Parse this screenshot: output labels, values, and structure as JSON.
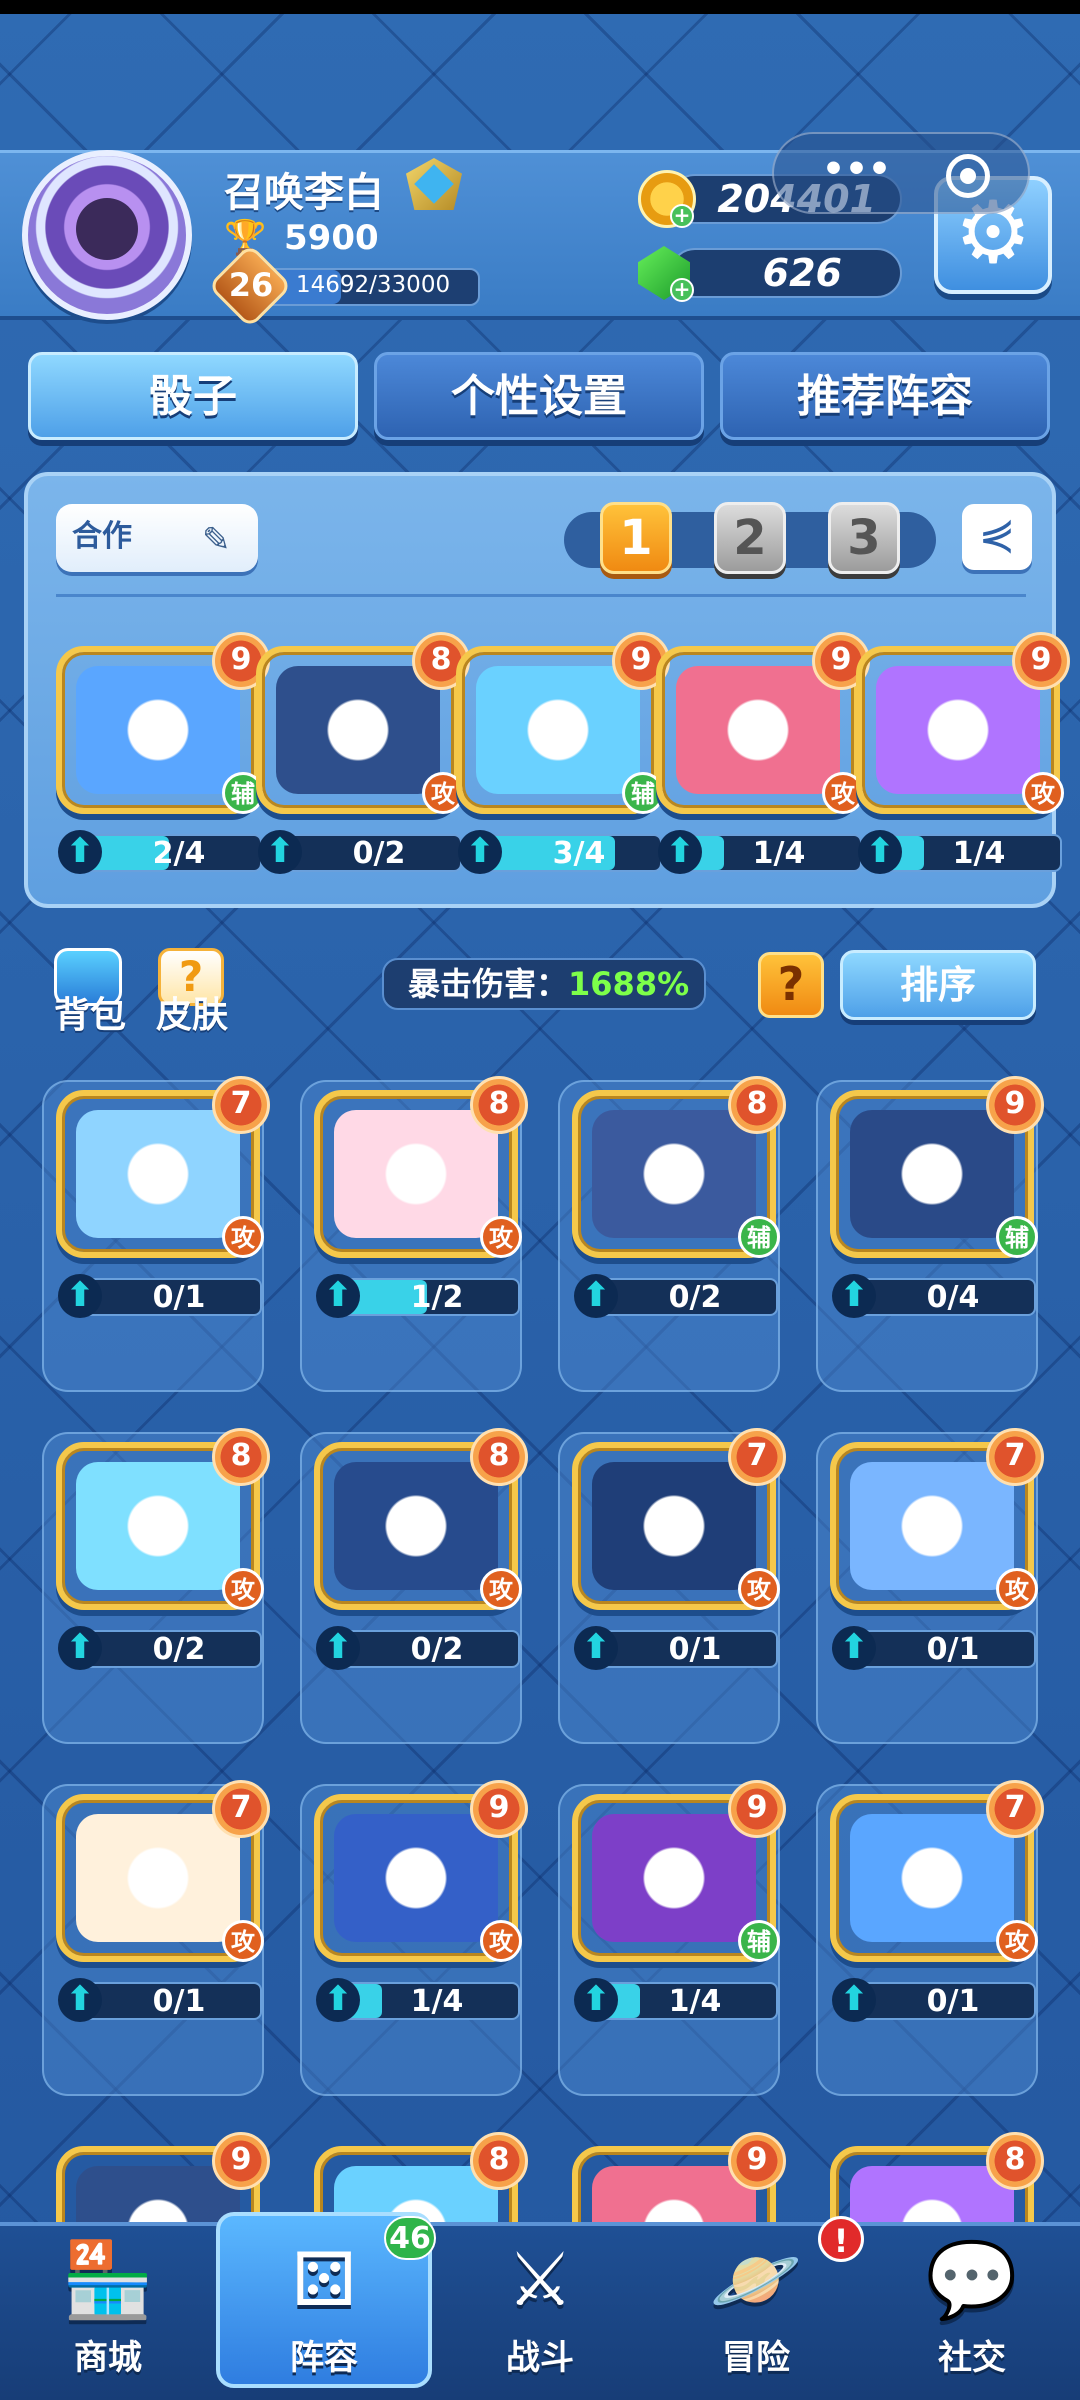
{
  "colors": {
    "accent": "#4ea0e8",
    "attack_role": "#e0601f",
    "support_role": "#3ab54a",
    "crit_value": "#7dff4a",
    "gold": "#ffc23a"
  },
  "player": {
    "name": "召唤李白",
    "trophies": "5900",
    "level": "26",
    "xp": "14692/33000",
    "xp_fraction": 0.445
  },
  "currency": {
    "gold": "204401",
    "gems": "626"
  },
  "tabs": [
    "骰子",
    "个性设置",
    "推荐阵容"
  ],
  "deck": {
    "name": "合作",
    "pages": [
      "1",
      "2",
      "3"
    ],
    "active_page": "1",
    "slots": [
      {
        "icon": "ninja-mask-icon",
        "level": "9",
        "role": "辅",
        "progress": "2/4",
        "fraction": 0.5
      },
      {
        "icon": "lion-icon",
        "level": "8",
        "role": "攻",
        "progress": "0/2",
        "fraction": 0
      },
      {
        "icon": "vortex-icon",
        "level": "9",
        "role": "辅",
        "progress": "3/4",
        "fraction": 0.75
      },
      {
        "icon": "red-gift-icon",
        "level": "9",
        "role": "攻",
        "progress": "1/4",
        "fraction": 0.25
      },
      {
        "icon": "purple-cross-icon",
        "level": "9",
        "role": "攻",
        "progress": "1/4",
        "fraction": 0.25
      }
    ]
  },
  "side": {
    "bag_label": "背包",
    "skin_label": "皮肤"
  },
  "crit": {
    "label": "暴击伤害：",
    "value": "1688%"
  },
  "help_label": "?",
  "sort_label": "排序",
  "collection": [
    {
      "icon": "shark-icon",
      "level": "7",
      "role": "攻",
      "progress": "0/1",
      "fraction": 0
    },
    {
      "icon": "rabbit-icon",
      "level": "8",
      "role": "攻",
      "progress": "1/2",
      "fraction": 0.5
    },
    {
      "icon": "ram-icon",
      "level": "8",
      "role": "辅",
      "progress": "0/2",
      "fraction": 0
    },
    {
      "icon": "libra-scales-icon",
      "level": "9",
      "role": "辅",
      "progress": "0/4",
      "fraction": 0
    },
    {
      "icon": "virgo-maiden-icon",
      "level": "8",
      "role": "攻",
      "progress": "0/2",
      "fraction": 0
    },
    {
      "icon": "leo-lion-icon",
      "level": "8",
      "role": "攻",
      "progress": "0/2",
      "fraction": 0
    },
    {
      "icon": "crab-icon",
      "level": "7",
      "role": "攻",
      "progress": "0/1",
      "fraction": 0
    },
    {
      "icon": "pisces-fish-icon",
      "level": "7",
      "role": "攻",
      "progress": "0/1",
      "fraction": 0
    },
    {
      "icon": "aquarius-icon",
      "level": "7",
      "role": "攻",
      "progress": "0/1",
      "fraction": 0
    },
    {
      "icon": "tiger-icon",
      "level": "9",
      "role": "攻",
      "progress": "1/4",
      "fraction": 0.25
    },
    {
      "icon": "shield-cross-icon",
      "level": "9",
      "role": "辅",
      "progress": "1/4",
      "fraction": 0.25
    },
    {
      "icon": "vampire-icon",
      "level": "7",
      "role": "攻",
      "progress": "0/1",
      "fraction": 0
    },
    {
      "icon": "dragon-icon",
      "level": "9",
      "role": "",
      "progress": "",
      "fraction": 0
    },
    {
      "icon": "snow-icon",
      "level": "8",
      "role": "",
      "progress": "",
      "fraction": 0
    },
    {
      "icon": "purple-orb-icon",
      "level": "9",
      "role": "",
      "progress": "",
      "fraction": 0
    },
    {
      "icon": "tree-icon",
      "level": "8",
      "role": "",
      "progress": "",
      "fraction": 0
    }
  ],
  "nav": [
    {
      "label": "商城",
      "icon": "shop-icon"
    },
    {
      "label": "阵容",
      "icon": "dice-icon",
      "badge": "46"
    },
    {
      "label": "战斗",
      "icon": "crossed-swords-icon"
    },
    {
      "label": "冒险",
      "icon": "planet-icon",
      "alert": "!"
    },
    {
      "label": "社交",
      "icon": "chat-bubbles-icon"
    }
  ]
}
